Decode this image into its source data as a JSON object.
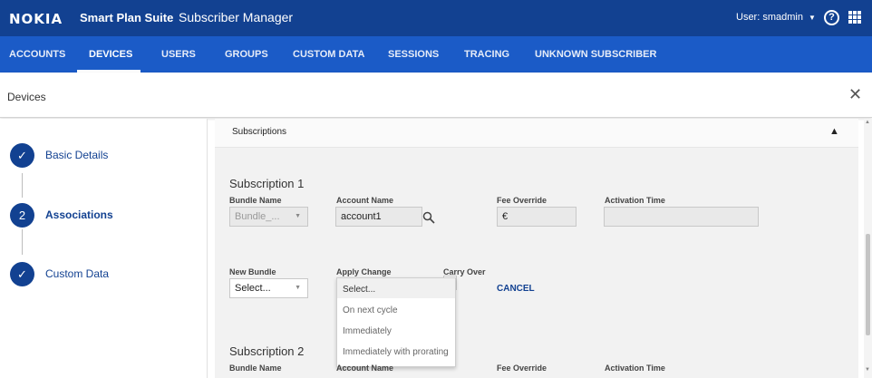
{
  "header": {
    "logo": "NOKIA",
    "suite": "Smart Plan Suite",
    "app": "Subscriber Manager",
    "user": "User: smadmin",
    "help_glyph": "?"
  },
  "nav": {
    "items": [
      "ACCOUNTS",
      "DEVICES",
      "USERS",
      "GROUPS",
      "CUSTOM DATA",
      "SESSIONS",
      "TRACING",
      "UNKNOWN SUBSCRIBER"
    ],
    "active": "DEVICES"
  },
  "page": {
    "title": "Devices",
    "close_glyph": "✕"
  },
  "steps": [
    {
      "label": "Basic Details",
      "marker": "✓",
      "state": "done"
    },
    {
      "label": "Associations",
      "marker": "2",
      "state": "current"
    },
    {
      "label": "Custom Data",
      "marker": "✓",
      "state": "done"
    }
  ],
  "section": {
    "title": "Subscriptions"
  },
  "subscription1": {
    "title": "Subscription 1",
    "labels": {
      "bundle": "Bundle Name",
      "account": "Account Name",
      "fee": "Fee Override",
      "activation": "Activation Time"
    },
    "bundle_value": "Bundle_...",
    "account_value": "account1",
    "fee_value": "€",
    "activation_value": ""
  },
  "change": {
    "labels": {
      "new_bundle": "New Bundle",
      "apply": "Apply Change",
      "carry": "Carry Over"
    },
    "new_bundle_value": "Select...",
    "cancel_label": "CANCEL",
    "dropdown_options": [
      "Select...",
      "On next cycle",
      "Immediately",
      "Immediately with prorating"
    ]
  },
  "subscription2": {
    "title": "Subscription 2",
    "labels": {
      "bundle": "Bundle Name",
      "account": "Account Name",
      "fee": "Fee Override",
      "activation": "Activation Time"
    }
  },
  "colors": {
    "header_bg": "#124191",
    "nav_bg": "#1b5bc7",
    "accent": "#124191"
  },
  "icons": [
    "check-icon",
    "search-icon",
    "help-icon",
    "apps-grid-icon",
    "close-icon",
    "chevron-up-icon",
    "caret-down-icon"
  ]
}
